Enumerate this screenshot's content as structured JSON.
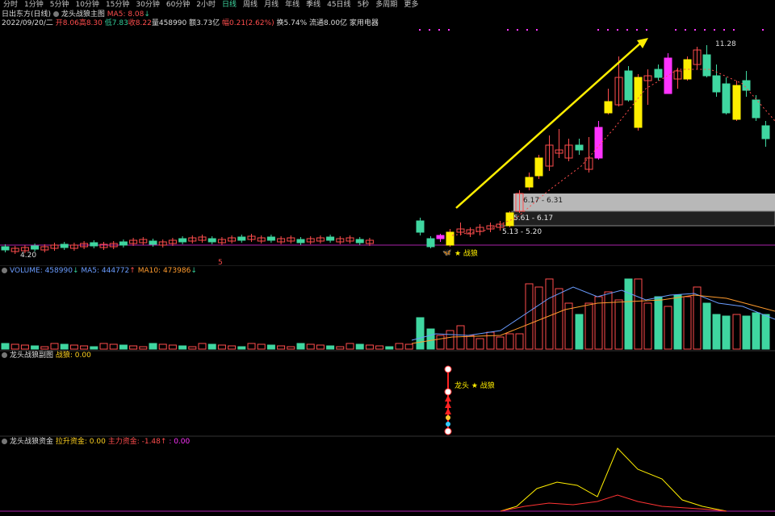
{
  "toolbar": {
    "periods": [
      "分时",
      "1分钟",
      "5分钟",
      "10分钟",
      "15分钟",
      "30分钟",
      "60分钟",
      "2小时",
      "日线",
      "周线",
      "月线",
      "年线",
      "季线",
      "45日线",
      "5秒",
      "多周期",
      "更多"
    ],
    "active_period": "日线"
  },
  "quote": {
    "stock_name": "日出东方(日线)",
    "indicator_name": "龙头战狼主图",
    "ma5_label": "MA5: 8.08",
    "date": "2022/09/20/二",
    "open": "开8.06",
    "high": "高8.30",
    "low": "低7.83",
    "close": "收8.22",
    "volume": "量458990",
    "amount": "额3.73亿",
    "change": "幅0.21(2.62%)",
    "turnover": "换5.74%",
    "float_cap": "流通8.00亿",
    "industry": "家用电器"
  },
  "main_chart": {
    "high_label": "11.28",
    "low_label": "4.20",
    "marker_5": "5",
    "zhanlang_label": "★ 战狼",
    "ranges": [
      "6.17 - 6.31",
      "5.61 - 6.17",
      "5.13 - 5.20"
    ]
  },
  "volume_panel": {
    "title": "VOLUME: 458990",
    "ma5": "MA5: 444772",
    "ma10": "MA10: 473986"
  },
  "sub_panel": {
    "title": "龙头战狼副图",
    "value": "战狼: 0.00",
    "annotation": "龙头 ★ 战狼"
  },
  "fund_panel": {
    "title": "龙头战狼资金",
    "lift": "拉升资金: 0.00",
    "main": "主力资金: -1.48",
    "third": ": 0.00"
  },
  "colors": {
    "up": "#ff4d4d",
    "down": "#3fd6a0",
    "yellow": "#ffee00",
    "magenta": "#ff33ff",
    "ma5": "#6a9cff",
    "ma10": "#ff9b2e"
  }
}
